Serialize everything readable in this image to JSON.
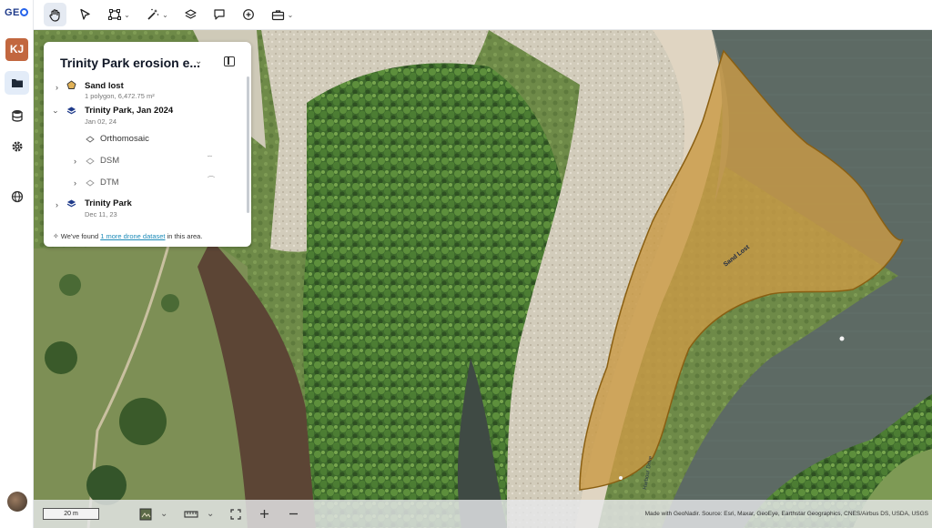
{
  "app": {
    "logo_prefix": "GE",
    "logo_suffix": ""
  },
  "rail": {
    "initials": "KJ"
  },
  "panel": {
    "title": "Trinity Park erosion e...",
    "layers": [
      {
        "name": "Sand lost",
        "detail": "1 polygon, 6,472.75 m²"
      },
      {
        "name": "Trinity Park, Jan 2024",
        "detail": "Jan 02, 24",
        "children": [
          {
            "name": "Orthomosaic"
          },
          {
            "name": "DSM",
            "tail": "˘˘"
          },
          {
            "name": "DTM",
            "tail": "⌒"
          }
        ]
      },
      {
        "name": "Trinity Park",
        "detail": "Dec 11, 23"
      }
    ],
    "found_prefix": "We've found",
    "found_link": "1 more drone dataset",
    "found_suffix": "in this area."
  },
  "map": {
    "polygon_label": "Sand Lost",
    "road_label": "Harbour Drive",
    "polygon_color": "#c99a45"
  },
  "bottombar": {
    "scale": "20 m",
    "credits": "Made with GeoNadir. Source: Esri, Maxar, GeoEye, Earthstar Geographics, CNES/Airbus DS, USDA, USGS"
  }
}
